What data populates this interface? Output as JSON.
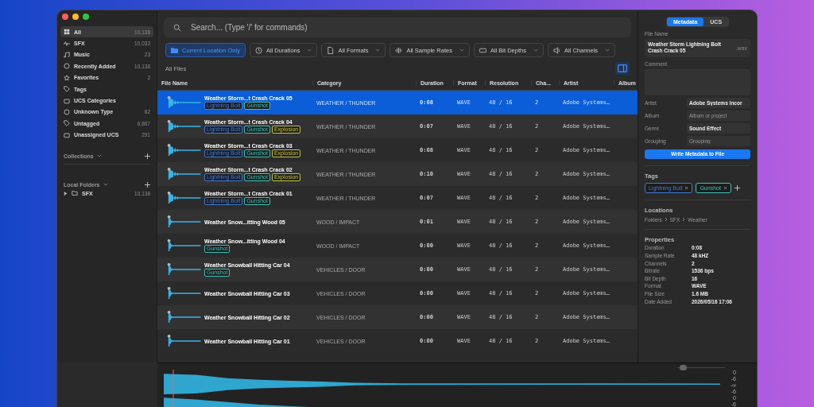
{
  "sidebar": {
    "items": [
      {
        "label": "All",
        "count": "10,138",
        "selected": true
      },
      {
        "label": "SFX",
        "count": "10,033",
        "selected": false
      },
      {
        "label": "Music",
        "count": "23",
        "selected": false
      },
      {
        "label": "Recently Added",
        "count": "10,138",
        "selected": false
      },
      {
        "label": "Favorites",
        "count": "2",
        "selected": false
      },
      {
        "label": "Tags",
        "selected": false
      },
      {
        "label": "UCS Categories",
        "selected": false
      },
      {
        "label": "Unknown Type",
        "count": "82",
        "selected": false
      },
      {
        "label": "Untagged",
        "count": "6,867",
        "selected": false
      },
      {
        "label": "Unassigned UCS",
        "count": "291",
        "selected": false
      }
    ],
    "collections": {
      "title": "Collections"
    },
    "local_folders": {
      "title": "Local Folders",
      "items": [
        {
          "label": "SFX",
          "count": "10,138",
          "expanded": false
        }
      ]
    }
  },
  "search": {
    "placeholder": "Search... (Type '/' for commands)"
  },
  "filters": [
    {
      "label": "Current Location Only",
      "selected": true
    },
    {
      "label": "All Durations",
      "selected": false
    },
    {
      "label": "All Formats",
      "selected": false
    },
    {
      "label": "All Sample Rates",
      "selected": false
    },
    {
      "label": "All Bit Depths",
      "selected": false
    },
    {
      "label": "All Channels",
      "selected": false
    }
  ],
  "table": {
    "title": "All Files",
    "columns": [
      "File Name",
      "Category",
      "Duration",
      "Format",
      "Resolution",
      "Cha...",
      "Artist",
      "Album"
    ],
    "rows": [
      {
        "name": "Weather Storm...t Crash Crack 05",
        "tags": [
          {
            "label": "Lightning Bolt",
            "color": "#3f78d8"
          },
          {
            "label": "Gunshot",
            "color": "#3cc4ba"
          }
        ],
        "category": "WEATHER / THUNDER",
        "duration": "0:08",
        "format": "WAVE",
        "resolution": "48 / 16",
        "channels": "2",
        "artist": "Adobe Systems…",
        "selected": true
      },
      {
        "name": "Weather Storm...t Crash Crack 04",
        "tags": [
          {
            "label": "Lightning Bolt",
            "color": "#3f78d8"
          },
          {
            "label": "Gunshot",
            "color": "#3cc4ba"
          },
          {
            "label": "Explosion",
            "color": "#c9c43c"
          }
        ],
        "category": "WEATHER / THUNDER",
        "duration": "0:07",
        "format": "WAVE",
        "resolution": "48 / 16",
        "channels": "2",
        "artist": "Adobe Systems…",
        "selected": false
      },
      {
        "name": "Weather Storm...t Crash Crack 03",
        "tags": [
          {
            "label": "Lightning Bolt",
            "color": "#3f78d8"
          },
          {
            "label": "Gunshot",
            "color": "#3cc4ba"
          },
          {
            "label": "Explosion",
            "color": "#c9c43c"
          }
        ],
        "category": "WEATHER / THUNDER",
        "duration": "0:08",
        "format": "WAVE",
        "resolution": "48 / 16",
        "channels": "2",
        "artist": "Adobe Systems…",
        "selected": false
      },
      {
        "name": "Weather Storm...t Crash Crack 02",
        "tags": [
          {
            "label": "Lightning Bolt",
            "color": "#3f78d8"
          },
          {
            "label": "Gunshot",
            "color": "#3cc4ba"
          },
          {
            "label": "Explosion",
            "color": "#c9c43c"
          }
        ],
        "category": "WEATHER / THUNDER",
        "duration": "0:10",
        "format": "WAVE",
        "resolution": "48 / 16",
        "channels": "2",
        "artist": "Adobe Systems…",
        "selected": false
      },
      {
        "name": "Weather Storm...t Crash Crack 01",
        "tags": [
          {
            "label": "Lightning Bolt",
            "color": "#3f78d8"
          },
          {
            "label": "Gunshot",
            "color": "#3cc4ba"
          }
        ],
        "category": "WEATHER / THUNDER",
        "duration": "0:07",
        "format": "WAVE",
        "resolution": "48 / 16",
        "channels": "2",
        "artist": "Adobe Systems…",
        "selected": false
      },
      {
        "name": "Weather Snow...itting Wood 05",
        "tags": [],
        "category": "WOOD / IMPACT",
        "duration": "0:01",
        "format": "WAVE",
        "resolution": "48 / 16",
        "channels": "2",
        "artist": "Adobe Systems…",
        "selected": false
      },
      {
        "name": "Weather Snow...itting Wood 04",
        "tags": [
          {
            "label": "Gunshot",
            "color": "#3cc4ba"
          }
        ],
        "category": "WOOD / IMPACT",
        "duration": "0:00",
        "format": "WAVE",
        "resolution": "48 / 16",
        "channels": "2",
        "artist": "Adobe Systems…",
        "selected": false
      },
      {
        "name": "Weather Snowball Hitting Car 04",
        "tags": [
          {
            "label": "Gunshot",
            "color": "#3cc4ba"
          }
        ],
        "category": "VEHICLES / DOOR",
        "duration": "0:00",
        "format": "WAVE",
        "resolution": "48 / 16",
        "channels": "2",
        "artist": "Adobe Systems…",
        "selected": false
      },
      {
        "name": "Weather Snowball Hitting Car 03",
        "tags": [],
        "category": "VEHICLES / DOOR",
        "duration": "0:00",
        "format": "WAVE",
        "resolution": "48 / 16",
        "channels": "2",
        "artist": "Adobe Systems…",
        "selected": false
      },
      {
        "name": "Weather Snowball Hitting Car 02",
        "tags": [],
        "category": "VEHICLES / DOOR",
        "duration": "0:00",
        "format": "WAVE",
        "resolution": "48 / 16",
        "channels": "2",
        "artist": "Adobe Systems…",
        "selected": false
      },
      {
        "name": "Weather Snowball Hitting Car 01",
        "tags": [],
        "category": "VEHICLES / DOOR",
        "duration": "0:00",
        "format": "WAVE",
        "resolution": "48 / 16",
        "channels": "2",
        "artist": "Adobe Systems…",
        "selected": false
      }
    ]
  },
  "inspector": {
    "tabs": [
      {
        "label": "Metadata",
        "selected": true
      },
      {
        "label": "UCS",
        "selected": false
      }
    ],
    "file_name": {
      "label": "File Name",
      "value": "Weather Storm Lightning Bolt Crash Crack 05",
      "extension": ".wav"
    },
    "comment": {
      "label": "Comment"
    },
    "fields": [
      {
        "label": "Artist",
        "value": "Adobe Systems Incor"
      },
      {
        "label": "Album",
        "placeholder": "Album or project"
      },
      {
        "label": "Genre",
        "value": "Sound Effect"
      },
      {
        "label": "Grouping",
        "placeholder": "Grouping"
      }
    ],
    "write_button": "Write Metadata to File",
    "tags": {
      "title": "Tags",
      "items": [
        {
          "label": "Lightning Bolt",
          "color": "#3f78d8"
        },
        {
          "label": "Gunshot",
          "color": "#3cc4ba"
        }
      ]
    },
    "locations": {
      "title": "Locations",
      "path": [
        "Folders",
        "SFX",
        "Weather"
      ]
    },
    "properties": {
      "title": "Properties",
      "items": [
        {
          "label": "Duration",
          "value": "0:08"
        },
        {
          "label": "Sample Rate",
          "value": "48 kHZ"
        },
        {
          "label": "Channels",
          "value": "2"
        },
        {
          "label": "Bitrate",
          "value": "1536 bps"
        },
        {
          "label": "Bit Depth",
          "value": "16"
        },
        {
          "label": "Format",
          "value": "WAVE"
        },
        {
          "label": "File Size",
          "value": "1.6 MB"
        },
        {
          "label": "Date Added",
          "value": "2026/05/16 17:06"
        }
      ]
    }
  },
  "waveform": {
    "zoom": {
      "level": 0.05
    },
    "scale_labels": [
      "0",
      "-6",
      "-∞",
      "-6",
      "0",
      "-6"
    ]
  }
}
